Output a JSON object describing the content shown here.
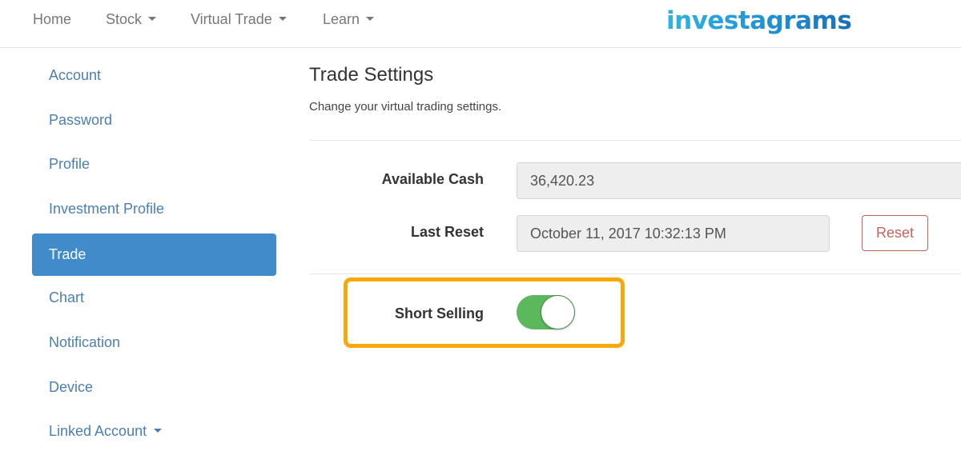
{
  "header": {
    "nav": [
      {
        "label": "Home",
        "has_dropdown": false
      },
      {
        "label": "Stock",
        "has_dropdown": true
      },
      {
        "label": "Virtual Trade",
        "has_dropdown": true
      },
      {
        "label": "Learn",
        "has_dropdown": true
      }
    ],
    "logo_text": "investagrams"
  },
  "sidebar": {
    "items": [
      {
        "label": "Account",
        "active": false
      },
      {
        "label": "Password",
        "active": false
      },
      {
        "label": "Profile",
        "active": false
      },
      {
        "label": "Investment Profile",
        "active": false
      },
      {
        "label": "Trade",
        "active": true
      },
      {
        "label": "Chart",
        "active": false
      },
      {
        "label": "Notification",
        "active": false
      },
      {
        "label": "Device",
        "active": false
      },
      {
        "label": "Linked Account",
        "active": false,
        "has_dropdown": true
      }
    ]
  },
  "main": {
    "title": "Trade Settings",
    "subtitle": "Change your virtual trading settings.",
    "fields": {
      "available_cash": {
        "label": "Available Cash",
        "value": "36,420.23"
      },
      "last_reset": {
        "label": "Last Reset",
        "value": "October 11, 2017 10:32:13 PM"
      }
    },
    "reset_button": "Reset",
    "short_selling": {
      "label": "Short Selling",
      "enabled": true
    }
  },
  "colors": {
    "accent": "#428bca",
    "link": "#4a7fb5",
    "toggle_on": "#5cb85c",
    "reset": "#c9605c",
    "highlight": "#f9a80a"
  }
}
